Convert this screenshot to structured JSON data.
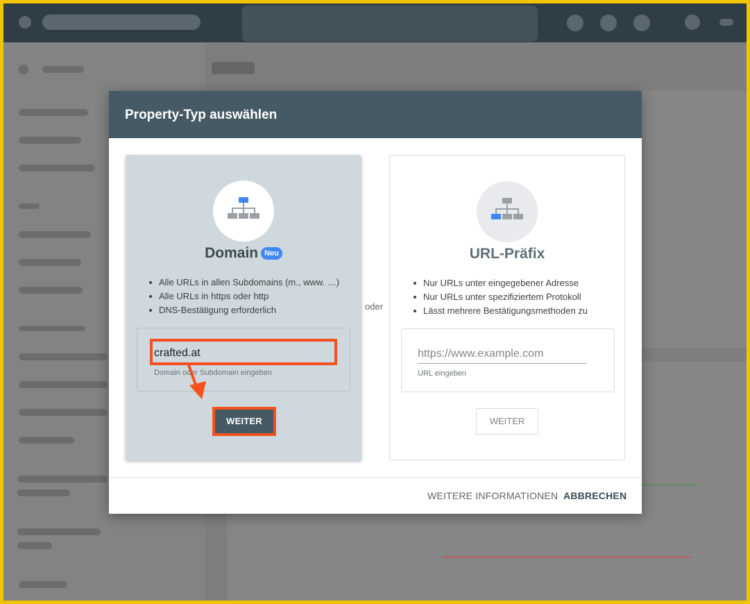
{
  "dialog": {
    "title": "Property-Typ auswählen",
    "separator": "oder",
    "footer": {
      "info_label": "WEITERE INFORMATIONEN",
      "cancel_label": "ABBRECHEN"
    }
  },
  "domain_card": {
    "title": "Domain",
    "badge": "Neu",
    "bullets": [
      "Alle URLs in allen Subdomains (m., www. …)",
      "Alle URLs in https oder http",
      "DNS-Bestätigung erforderlich"
    ],
    "input_value": "crafted.at",
    "helper": "Domain oder Subdomain eingeben",
    "button_label": "WEITER",
    "icon": "sitemap-icon"
  },
  "url_card": {
    "title": "URL-Präfix",
    "bullets": [
      "Nur URLs unter eingegebener Adresse",
      "Nur URLs unter spezifiziertem Protokoll",
      "Lässt mehrere Bestätigungsmethoden zu"
    ],
    "input_placeholder": "https://www.example.com",
    "helper": "URL eingeben",
    "button_label": "WEITER",
    "icon": "sitemap-icon"
  },
  "colors": {
    "header": "#455a64",
    "highlight": "#f4511e",
    "badge": "#4285f4",
    "frame": "#f0c400"
  }
}
